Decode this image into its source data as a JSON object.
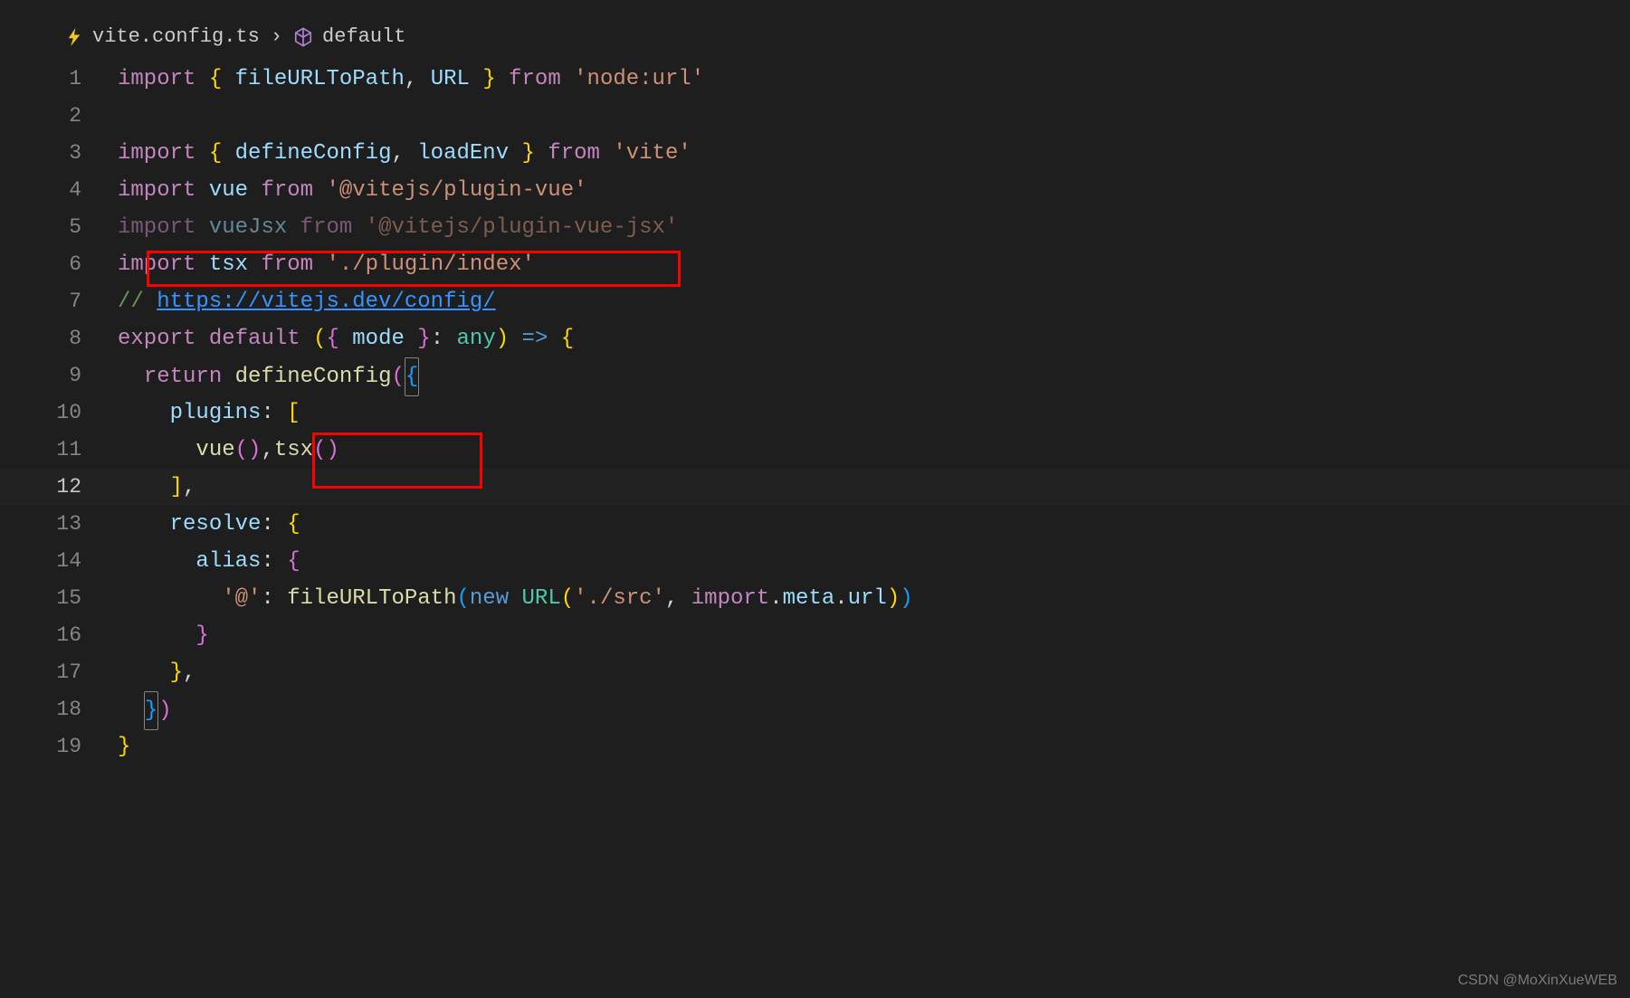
{
  "breadcrumb": {
    "file": "vite.config.ts",
    "symbol": "default"
  },
  "lines": [
    {
      "n": 1,
      "tokens": [
        {
          "t": "import",
          "c": "kw-import"
        },
        {
          "t": " "
        },
        {
          "t": "{",
          "c": "brace-1"
        },
        {
          "t": " "
        },
        {
          "t": "fileURLToPath",
          "c": "identifier"
        },
        {
          "t": ", "
        },
        {
          "t": "URL",
          "c": "identifier"
        },
        {
          "t": " "
        },
        {
          "t": "}",
          "c": "brace-1"
        },
        {
          "t": " "
        },
        {
          "t": "from",
          "c": "kw-from"
        },
        {
          "t": " "
        },
        {
          "t": "'node:url'",
          "c": "string"
        }
      ]
    },
    {
      "n": 2,
      "tokens": []
    },
    {
      "n": 3,
      "tokens": [
        {
          "t": "import",
          "c": "kw-import"
        },
        {
          "t": " "
        },
        {
          "t": "{",
          "c": "brace-1"
        },
        {
          "t": " "
        },
        {
          "t": "defineConfig",
          "c": "identifier"
        },
        {
          "t": ", "
        },
        {
          "t": "loadEnv",
          "c": "identifier"
        },
        {
          "t": " "
        },
        {
          "t": "}",
          "c": "brace-1"
        },
        {
          "t": " "
        },
        {
          "t": "from",
          "c": "kw-from"
        },
        {
          "t": " "
        },
        {
          "t": "'vite'",
          "c": "string"
        }
      ]
    },
    {
      "n": 4,
      "tokens": [
        {
          "t": "import",
          "c": "kw-import"
        },
        {
          "t": " "
        },
        {
          "t": "vue",
          "c": "identifier"
        },
        {
          "t": " "
        },
        {
          "t": "from",
          "c": "kw-from"
        },
        {
          "t": " "
        },
        {
          "t": "'@vitejs/plugin-vue'",
          "c": "string"
        }
      ]
    },
    {
      "n": 5,
      "dimmed": true,
      "tokens": [
        {
          "t": "import",
          "c": "kw-import"
        },
        {
          "t": " "
        },
        {
          "t": "vueJsx",
          "c": "identifier"
        },
        {
          "t": " "
        },
        {
          "t": "from",
          "c": "kw-from"
        },
        {
          "t": " "
        },
        {
          "t": "'@vitejs/plugin-vue-jsx'",
          "c": "string"
        }
      ]
    },
    {
      "n": 6,
      "tokens": [
        {
          "t": "import",
          "c": "kw-import"
        },
        {
          "t": " "
        },
        {
          "t": "tsx",
          "c": "identifier"
        },
        {
          "t": " "
        },
        {
          "t": "from",
          "c": "kw-from"
        },
        {
          "t": " "
        },
        {
          "t": "'./plugin/index'",
          "c": "string"
        }
      ]
    },
    {
      "n": 7,
      "tokens": [
        {
          "t": "// ",
          "c": "comment"
        },
        {
          "t": "https://vitejs.dev/config/",
          "c": "link"
        }
      ]
    },
    {
      "n": 8,
      "tokens": [
        {
          "t": "export",
          "c": "kw-export"
        },
        {
          "t": " "
        },
        {
          "t": "default",
          "c": "kw-default"
        },
        {
          "t": " "
        },
        {
          "t": "(",
          "c": "paren-1"
        },
        {
          "t": "{",
          "c": "brace-2"
        },
        {
          "t": " "
        },
        {
          "t": "mode",
          "c": "identifier"
        },
        {
          "t": " "
        },
        {
          "t": "}",
          "c": "brace-2"
        },
        {
          "t": ": "
        },
        {
          "t": "any",
          "c": "type-name"
        },
        {
          "t": ")",
          "c": "paren-1"
        },
        {
          "t": " "
        },
        {
          "t": "=>",
          "c": "arrow"
        },
        {
          "t": " "
        },
        {
          "t": "{",
          "c": "brace-1"
        }
      ]
    },
    {
      "n": 9,
      "tokens": [
        {
          "t": "  "
        },
        {
          "t": "return",
          "c": "kw-return"
        },
        {
          "t": " "
        },
        {
          "t": "defineConfig",
          "c": "fn-name"
        },
        {
          "t": "(",
          "c": "paren-2"
        },
        {
          "t": "{",
          "c": "brace-3",
          "cursor": true
        }
      ]
    },
    {
      "n": 10,
      "tokens": [
        {
          "t": "    "
        },
        {
          "t": "plugins",
          "c": "identifier"
        },
        {
          "t": ":"
        },
        {
          "t": " "
        },
        {
          "t": "[",
          "c": "bracket-1"
        }
      ]
    },
    {
      "n": 11,
      "tokens": [
        {
          "t": "      "
        },
        {
          "t": "vue",
          "c": "fn-name"
        },
        {
          "t": "(",
          "c": "paren-2"
        },
        {
          "t": ")",
          "c": "paren-2"
        },
        {
          "t": ","
        },
        {
          "t": "tsx",
          "c": "fn-name"
        },
        {
          "t": "(",
          "c": "paren-2"
        },
        {
          "t": ")",
          "c": "paren-2"
        }
      ]
    },
    {
      "n": 12,
      "active": true,
      "tokens": [
        {
          "t": "    "
        },
        {
          "t": "]",
          "c": "bracket-1"
        },
        {
          "t": ","
        }
      ]
    },
    {
      "n": 13,
      "tokens": [
        {
          "t": "    "
        },
        {
          "t": "resolve",
          "c": "identifier"
        },
        {
          "t": ":"
        },
        {
          "t": " "
        },
        {
          "t": "{",
          "c": "brace-1"
        }
      ]
    },
    {
      "n": 14,
      "tokens": [
        {
          "t": "      "
        },
        {
          "t": "alias",
          "c": "identifier"
        },
        {
          "t": ":"
        },
        {
          "t": " "
        },
        {
          "t": "{",
          "c": "brace-2"
        }
      ]
    },
    {
      "n": 15,
      "tokens": [
        {
          "t": "        "
        },
        {
          "t": "'@'",
          "c": "string"
        },
        {
          "t": ": "
        },
        {
          "t": "fileURLToPath",
          "c": "fn-name"
        },
        {
          "t": "(",
          "c": "paren-3"
        },
        {
          "t": "new",
          "c": "kw-new"
        },
        {
          "t": " "
        },
        {
          "t": "URL",
          "c": "type-name"
        },
        {
          "t": "(",
          "c": "paren-1"
        },
        {
          "t": "'./src'",
          "c": "string"
        },
        {
          "t": ", "
        },
        {
          "t": "import",
          "c": "kw-import"
        },
        {
          "t": "."
        },
        {
          "t": "meta",
          "c": "identifier"
        },
        {
          "t": "."
        },
        {
          "t": "url",
          "c": "identifier"
        },
        {
          "t": ")",
          "c": "paren-1"
        },
        {
          "t": ")",
          "c": "paren-3"
        }
      ]
    },
    {
      "n": 16,
      "tokens": [
        {
          "t": "      "
        },
        {
          "t": "}",
          "c": "brace-2"
        }
      ]
    },
    {
      "n": 17,
      "tokens": [
        {
          "t": "    "
        },
        {
          "t": "}",
          "c": "brace-1"
        },
        {
          "t": ","
        }
      ]
    },
    {
      "n": 18,
      "tokens": [
        {
          "t": "  "
        },
        {
          "t": "}",
          "c": "brace-3",
          "cursor": true
        },
        {
          "t": ")",
          "c": "paren-2"
        }
      ]
    },
    {
      "n": 19,
      "tokens": [
        {
          "t": "}",
          "c": "brace-1"
        }
      ]
    }
  ],
  "watermark": "CSDN @MoXinXueWEB"
}
